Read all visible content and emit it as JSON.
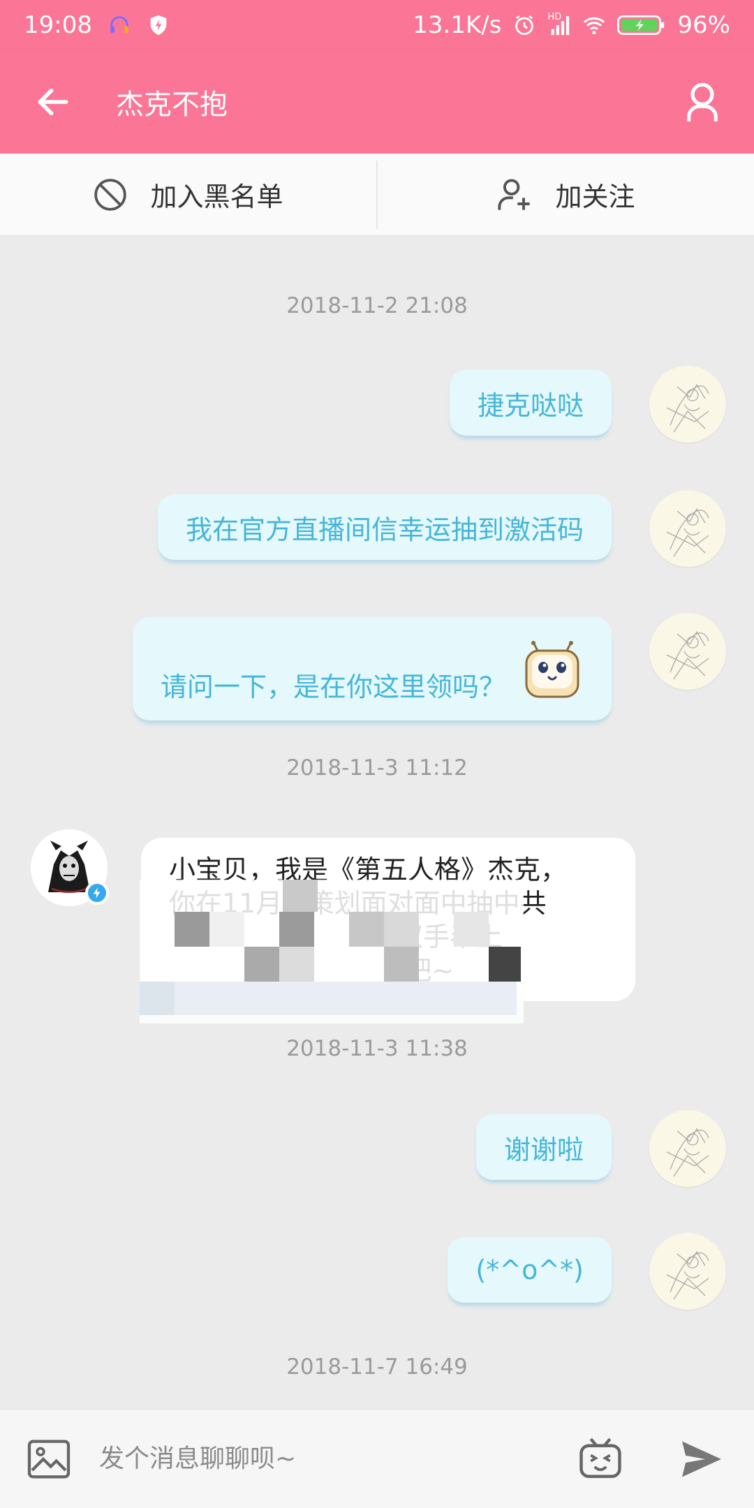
{
  "status_bar": {
    "time": "19:08",
    "network_speed": "13.1K/s",
    "network_type": "HD",
    "battery": "96%",
    "icons": [
      "headset-icon",
      "shield-icon",
      "alarm-icon",
      "signal-icon",
      "wifi-icon",
      "battery-icon"
    ]
  },
  "header": {
    "title": "杰克不抱",
    "back_icon": "arrow-left-icon",
    "profile_icon": "user-icon"
  },
  "actions": {
    "block_label": "加入黑名单",
    "follow_label": "加关注"
  },
  "messages": {
    "ts1": "2018-11-2 21:08",
    "msg1": "捷克哒哒",
    "msg2": "我在官方直播间信幸运抽到激活码",
    "msg3": "请问一下，是在你这里领吗？",
    "ts2": "2018-11-3 11:12",
    "reply_line1": "小宝贝，我是《第五人格》杰克，",
    "reply_line2": "你在11月   策划面对面中抽中共",
    "reply_line3": "                           双手奉上",
    "reply_line4": "                            吧~",
    "ts3": "2018-11-3 11:38",
    "msg4": "谢谢啦",
    "msg5": "(*^o^*)",
    "ts4": "2018-11-7 16:49"
  },
  "input": {
    "placeholder": "发个消息聊聊呗~"
  },
  "colors": {
    "brand": "#fb7596",
    "bubble_bg": "#e5f8fc",
    "bubble_text": "#46b6d8",
    "verified": "#35a9ee"
  }
}
